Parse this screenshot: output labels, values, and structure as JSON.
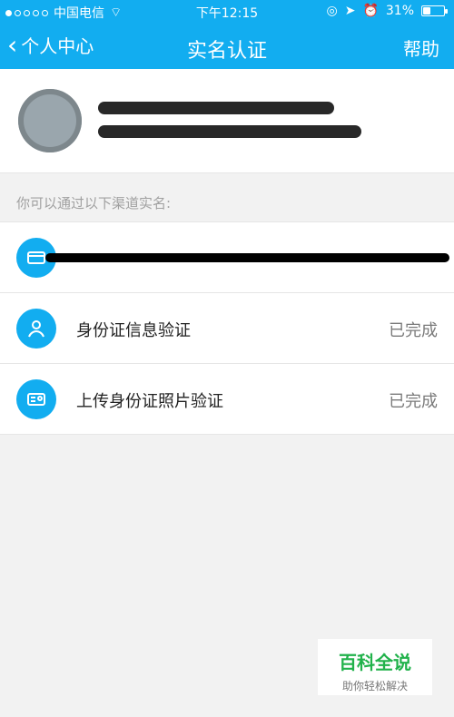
{
  "statusbar": {
    "carrier": "中国电信",
    "time": "下午12:15",
    "battery": "31%",
    "battery_level": 0.31
  },
  "nav": {
    "back_label": "个人中心",
    "title": "实名认证",
    "help_label": "帮助"
  },
  "section_hint": "你可以通过以下渠道实名:",
  "methods": [
    {
      "label": "身份证信息验证",
      "status": "已完成"
    },
    {
      "label": "上传身份证照片验证",
      "status": "已完成"
    }
  ],
  "watermark": {
    "title": "百科全说",
    "subtitle": "助你轻松解决"
  },
  "colors": {
    "primary": "#12adf0",
    "watermark_green": "#21b24b"
  }
}
